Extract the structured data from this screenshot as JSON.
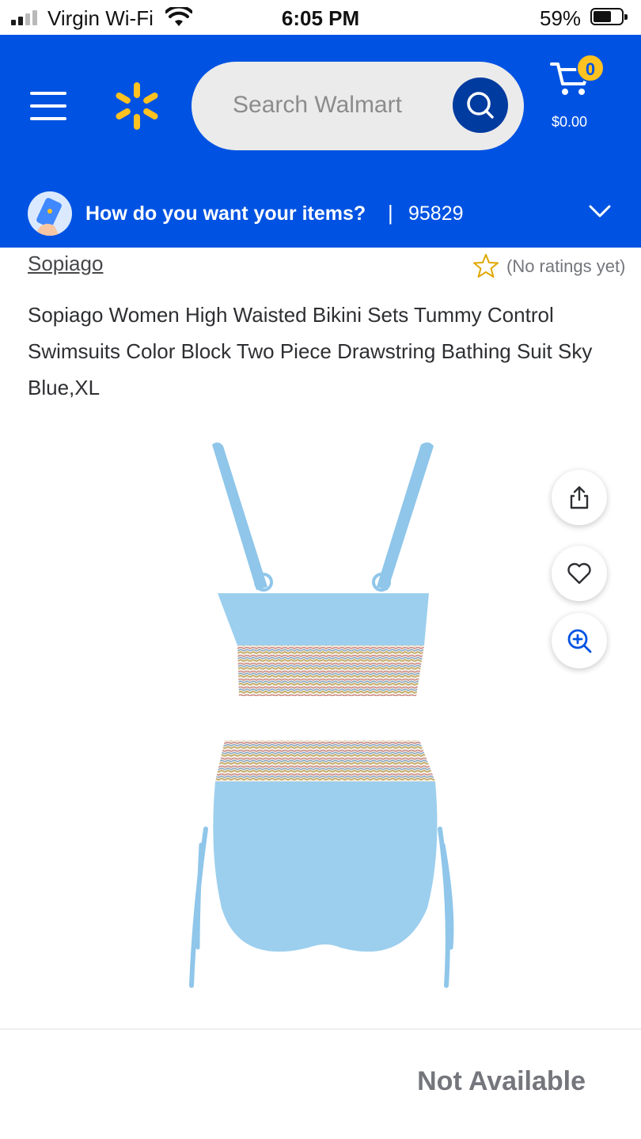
{
  "status_bar": {
    "carrier": "Virgin Wi-Fi",
    "time": "6:05 PM",
    "battery": "59%"
  },
  "header": {
    "search_placeholder": "Search Walmart",
    "cart_count": "0",
    "cart_total": "$0.00",
    "delivery_prompt": "How do you want your items?",
    "separator": "|",
    "zip": "95829",
    "brand_color": "#0053e2",
    "spark_color": "#ffc220"
  },
  "product": {
    "brand": "Sopiago",
    "rating_text": "(No ratings yet)",
    "title": "Sopiago Women High Waisted Bikini Sets Tummy Control Swimsuits Color Block Two Piece Drawstring Bathing Suit Sky Blue,XL",
    "image_icons": [
      "share-icon",
      "heart-icon",
      "zoom-in-icon"
    ]
  },
  "footer": {
    "availability": "Not Available"
  }
}
